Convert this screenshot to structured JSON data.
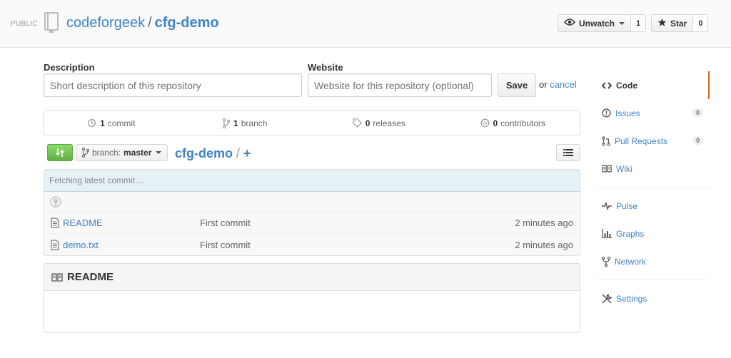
{
  "header": {
    "visibility": "PUBLIC",
    "owner": "codeforgeek",
    "separator": "/",
    "repo": "cfg-demo",
    "watch_label": "Unwatch",
    "watch_count": "1",
    "star_label": "Star",
    "star_count": "0"
  },
  "edit_form": {
    "description_label": "Description",
    "description_placeholder": "Short description of this repository",
    "website_label": "Website",
    "website_placeholder": "Website for this repository (optional)",
    "save_label": "Save",
    "or_text": "or",
    "cancel_label": "cancel"
  },
  "numbers": {
    "commits_count": "1",
    "commits_label": "commit",
    "branches_count": "1",
    "branches_label": "branch",
    "releases_count": "0",
    "releases_label": "releases",
    "contributors_count": "0",
    "contributors_label": "contributors"
  },
  "file_nav": {
    "branch_prefix": "branch:",
    "branch_name": "master",
    "breadcrumb_root": "cfg-demo",
    "breadcrumb_sep": "/",
    "new_file": "+"
  },
  "files": {
    "commit_status": "Fetching latest commit…",
    "rows": [
      {
        "name": "README",
        "message": "First commit",
        "age": "2 minutes ago"
      },
      {
        "name": "demo.txt",
        "message": "First commit",
        "age": "2 minutes ago"
      }
    ]
  },
  "readme": {
    "title": "README"
  },
  "sidebar": {
    "code": "Code",
    "issues": "Issues",
    "issues_count": "0",
    "pull_requests": "Pull Requests",
    "pull_requests_count": "0",
    "wiki": "Wiki",
    "pulse": "Pulse",
    "graphs": "Graphs",
    "network": "Network",
    "settings": "Settings"
  },
  "colors": {
    "link": "#4183c4",
    "accent_green": "#60b044",
    "selected_nav_border": "#d26911"
  }
}
